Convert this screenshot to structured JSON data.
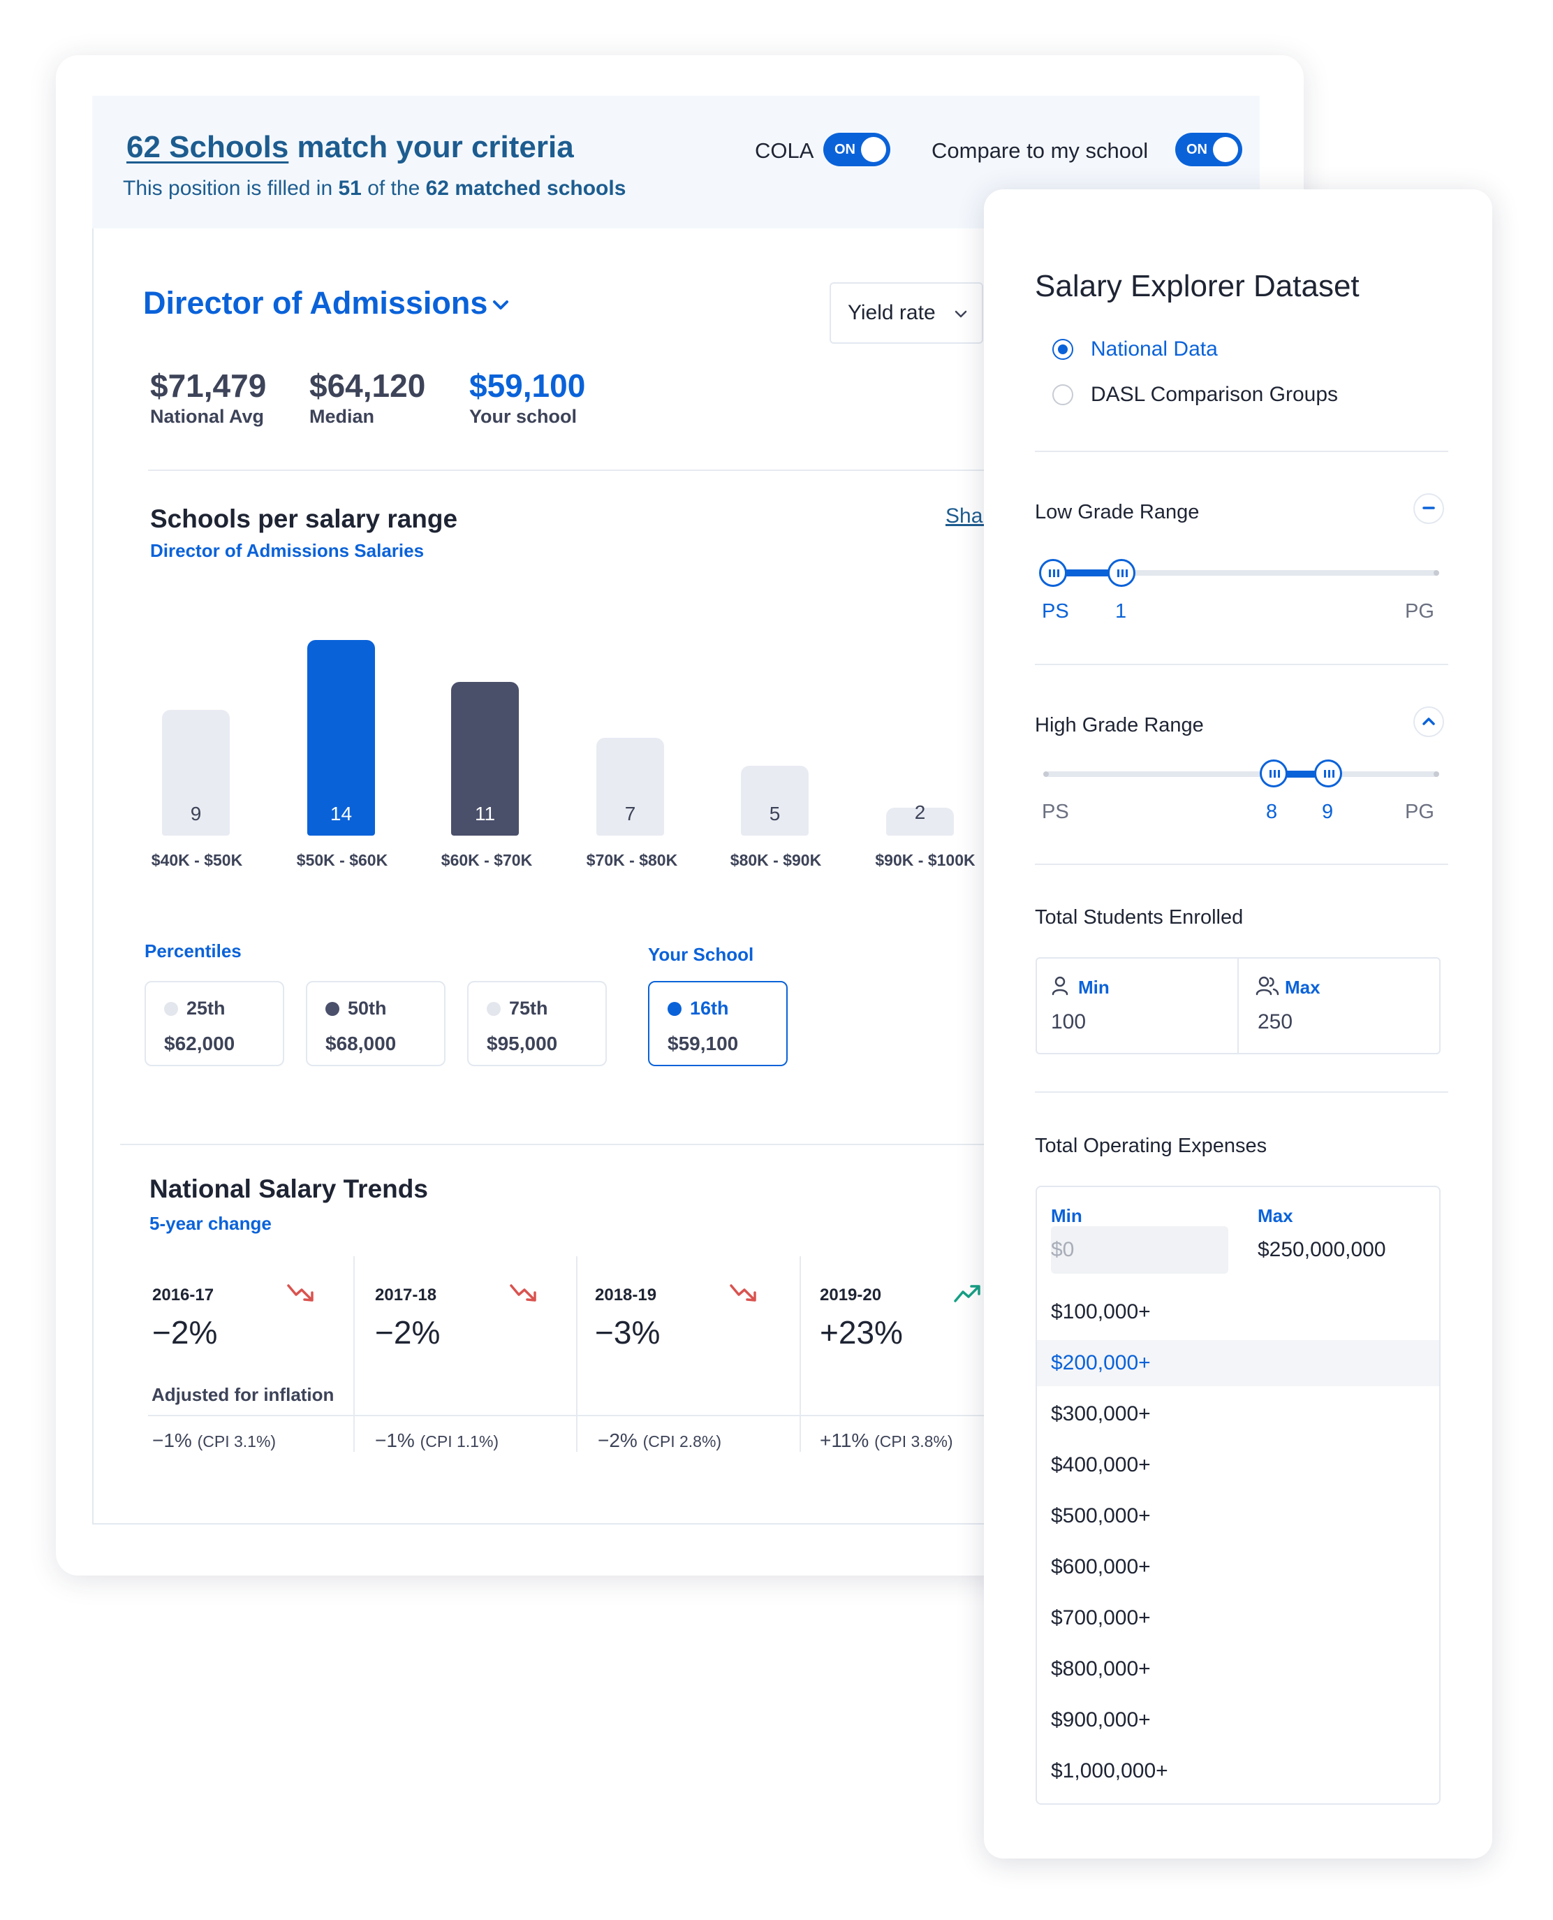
{
  "header": {
    "count_text": "62 Schools",
    "title_rest": "match your criteria",
    "sub_prefix": "This position is filled in",
    "sub_count": "51",
    "sub_mid": "of the",
    "sub_total": "62 matched schools",
    "toggles": [
      {
        "label": "COLA",
        "state": "ON"
      },
      {
        "label": "Compare to my school",
        "state": "ON"
      }
    ]
  },
  "role": {
    "title": "Director of Admissions",
    "metric_select": "Yield rate"
  },
  "stats": [
    {
      "value": "$71,479",
      "label": "National Avg"
    },
    {
      "value": "$64,120",
      "label": "Median"
    },
    {
      "value": "$59,100",
      "label": "Your school"
    }
  ],
  "distribution": {
    "title": "Schools per salary range",
    "subtitle": "Director of Admissions Salaries",
    "share_link": "Shar"
  },
  "chart_data": {
    "type": "bar",
    "categories": [
      "$40K - $50K",
      "$50K - $60K",
      "$60K - $70K",
      "$70K - $80K",
      "$80K - $90K",
      "$90K - $100K"
    ],
    "values": [
      9,
      14,
      11,
      7,
      5,
      2
    ],
    "colors": [
      "#e8ebf2",
      "#0a62d9",
      "#4a4f6a",
      "#e8ebf2",
      "#e8ebf2",
      "#e8ebf2"
    ],
    "ylim": [
      0,
      14
    ]
  },
  "percentiles": {
    "heading": "Percentiles",
    "your_heading": "Your School",
    "items": [
      {
        "rank": "25th",
        "amount": "$62,000",
        "dot": "#e3e6ec"
      },
      {
        "rank": "50th",
        "amount": "$68,000",
        "dot": "#4a4f6a"
      },
      {
        "rank": "75th",
        "amount": "$95,000",
        "dot": "#e3e6ec"
      }
    ],
    "your": {
      "rank": "16th",
      "amount": "$59,100",
      "dot": "#0a62d9"
    }
  },
  "trends": {
    "title": "National Salary Trends",
    "subtitle": "5-year change",
    "adjusted_label": "Adjusted for inflation",
    "items": [
      {
        "year": "2016-17",
        "change": "−2%",
        "direction": "down",
        "adj": "−1%",
        "cpi": "(CPI 3.1%)"
      },
      {
        "year": "2017-18",
        "change": "−2%",
        "direction": "down",
        "adj": "−1%",
        "cpi": "(CPI 1.1%)"
      },
      {
        "year": "2018-19",
        "change": "−3%",
        "direction": "down",
        "adj": "−2%",
        "cpi": "(CPI 2.8%)"
      },
      {
        "year": "2019-20",
        "change": "+23%",
        "direction": "up",
        "adj": "+11%",
        "cpi": "(CPI 3.8%)"
      }
    ],
    "down_color": "#d9534f",
    "up_color": "#16a085"
  },
  "side": {
    "title": "Salary Explorer Dataset",
    "dataset_options": [
      {
        "label": "National Data",
        "selected": true
      },
      {
        "label": "DASL Comparison Groups",
        "selected": false
      }
    ],
    "low_grade": {
      "title": "Low Grade Range",
      "toggle_icon": "minus-icon",
      "start_label": "PS",
      "end_label": "PG",
      "selected_low": "PS",
      "selected_high": "1"
    },
    "high_grade": {
      "title": "High Grade Range",
      "toggle_icon": "chevron-up-icon",
      "start_label": "PS",
      "end_label": "PG",
      "selected_low": "8",
      "selected_high": "9"
    },
    "students": {
      "title": "Total Students Enrolled",
      "min_label": "Min",
      "min_value": "100",
      "max_label": "Max",
      "max_value": "250"
    },
    "expenses": {
      "title": "Total Operating Expenses",
      "min_label": "Min",
      "min_placeholder": "$0",
      "max_label": "Max",
      "max_value": "$250,000,000",
      "options": [
        "$100,000+",
        "$200,000+",
        "$300,000+",
        "$400,000+",
        "$500,000+",
        "$600,000+",
        "$700,000+",
        "$800,000+",
        "$900,000+",
        "$1,000,000+"
      ],
      "hovered": "$200,000+"
    }
  },
  "accent": "#0a62d9"
}
